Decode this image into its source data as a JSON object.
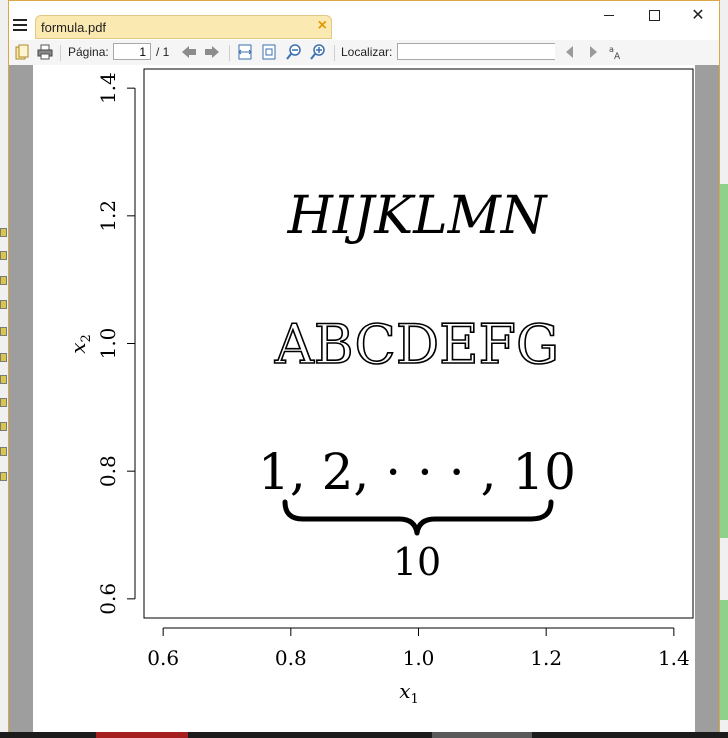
{
  "window": {
    "tab_title": "formula.pdf",
    "tab_close": "×",
    "minimize": "",
    "maximize": "",
    "close": "✕"
  },
  "toolbar": {
    "page_label": "Página:",
    "page_value": "1",
    "page_total": "/ 1",
    "search_label": "Localizar:",
    "search_value": ""
  },
  "icons": [
    "menu-icon",
    "open-icon",
    "print-icon",
    "prev-page-icon",
    "next-page-icon",
    "fit-width-icon",
    "fit-page-icon",
    "zoom-out-icon",
    "zoom-in-icon",
    "find-prev-icon",
    "find-next-icon",
    "match-case-icon"
  ],
  "document": {
    "calligraphic_line": "HIJKLMN",
    "blackboard_line": "ABCDEFG",
    "sequence_line": "1, 2, · · · , 10",
    "underbrace_label": "10",
    "x_axis_label": "x",
    "x_axis_subscript": "1",
    "y_axis_label": "x",
    "y_axis_subscript": "2",
    "x_ticks": [
      "0.6",
      "0.8",
      "1.0",
      "1.2",
      "1.4"
    ],
    "y_ticks": [
      "0.6",
      "0.8",
      "1.0",
      "1.2",
      "1.4"
    ]
  },
  "chart_data": {
    "type": "scatter",
    "xlabel": "x1",
    "ylabel": "x2",
    "xlim": [
      0.57,
      1.43
    ],
    "ylim": [
      0.57,
      1.43
    ],
    "x_ticks": [
      0.6,
      0.8,
      1.0,
      1.2,
      1.4
    ],
    "y_ticks": [
      0.6,
      0.8,
      1.0,
      1.2,
      1.4
    ],
    "annotations": [
      {
        "text": "HIJKLMN",
        "x": 1.0,
        "y": 1.2
      },
      {
        "text": "ABCDEFG",
        "x": 1.0,
        "y": 1.0
      },
      {
        "text": "1, 2, · · · , 10",
        "x": 1.0,
        "y": 0.8
      },
      {
        "text": "10",
        "x": 1.0,
        "y": 0.67
      }
    ]
  }
}
